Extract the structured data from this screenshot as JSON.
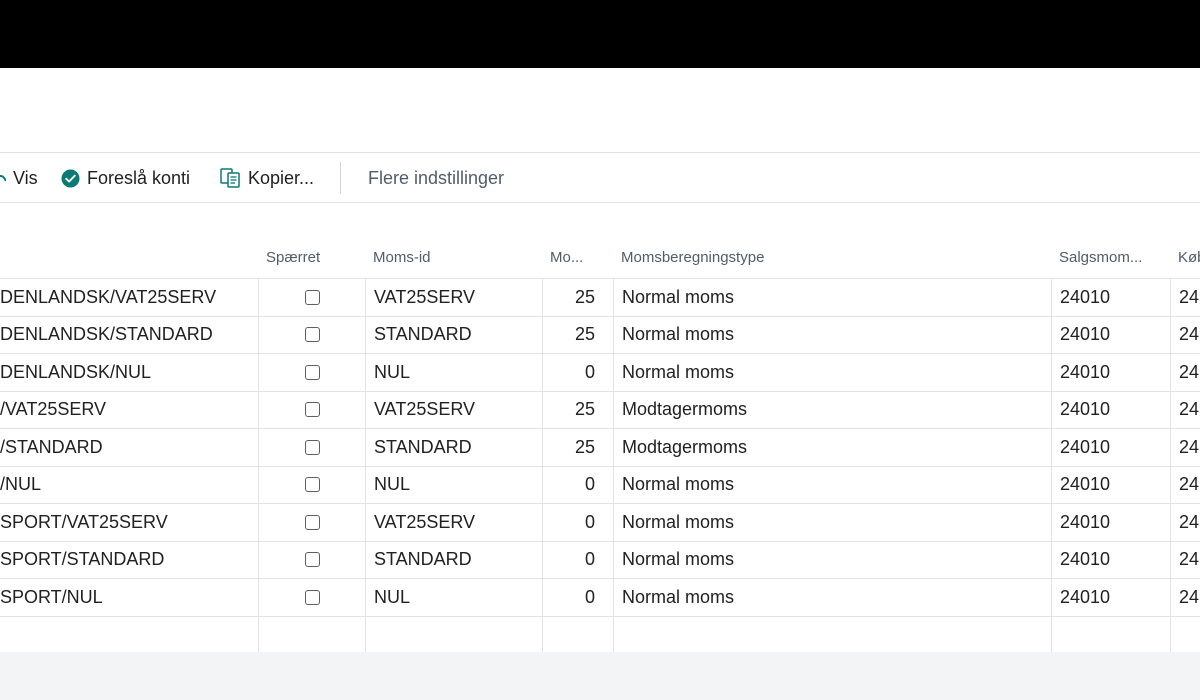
{
  "actions": {
    "vis": "Vis",
    "foresla": "Foreslå konti",
    "kopier": "Kopier...",
    "more": "Flere indstillinger"
  },
  "columns": {
    "code": "",
    "sparret": "Spærret",
    "moms_id": "Moms-id",
    "mo": "Mo...",
    "type": "Momsberegningstype",
    "salg": "Salgsmom...",
    "kob": "Køb"
  },
  "rows": [
    {
      "code": "DENLANDSK/VAT25SERV",
      "moms_id": "VAT25SERV",
      "mo": "25",
      "type": "Normal moms",
      "salg": "24010",
      "kob": "24"
    },
    {
      "code": "DENLANDSK/STANDARD",
      "moms_id": "STANDARD",
      "mo": "25",
      "type": "Normal moms",
      "salg": "24010",
      "kob": "24"
    },
    {
      "code": "DENLANDSK/NUL",
      "moms_id": "NUL",
      "mo": "0",
      "type": "Normal moms",
      "salg": "24010",
      "kob": "24"
    },
    {
      "code": "/VAT25SERV",
      "moms_id": "VAT25SERV",
      "mo": "25",
      "type": "Modtagermoms",
      "salg": "24010",
      "kob": "24"
    },
    {
      "code": "/STANDARD",
      "moms_id": "STANDARD",
      "mo": "25",
      "type": "Modtagermoms",
      "salg": "24010",
      "kob": "24"
    },
    {
      "code": "/NUL",
      "moms_id": "NUL",
      "mo": "0",
      "type": "Normal moms",
      "salg": "24010",
      "kob": "24"
    },
    {
      "code": "SPORT/VAT25SERV",
      "moms_id": "VAT25SERV",
      "mo": "0",
      "type": "Normal moms",
      "salg": "24010",
      "kob": "24"
    },
    {
      "code": "SPORT/STANDARD",
      "moms_id": "STANDARD",
      "mo": "0",
      "type": "Normal moms",
      "salg": "24010",
      "kob": "24"
    },
    {
      "code": "SPORT/NUL",
      "moms_id": "NUL",
      "mo": "0",
      "type": "Normal moms",
      "salg": "24010",
      "kob": "24"
    }
  ],
  "colors": {
    "accent": "#0b7a75",
    "header_text": "#505c6d",
    "grid_line": "#e3e3e3",
    "footer_bg": "#f3f4f6"
  }
}
